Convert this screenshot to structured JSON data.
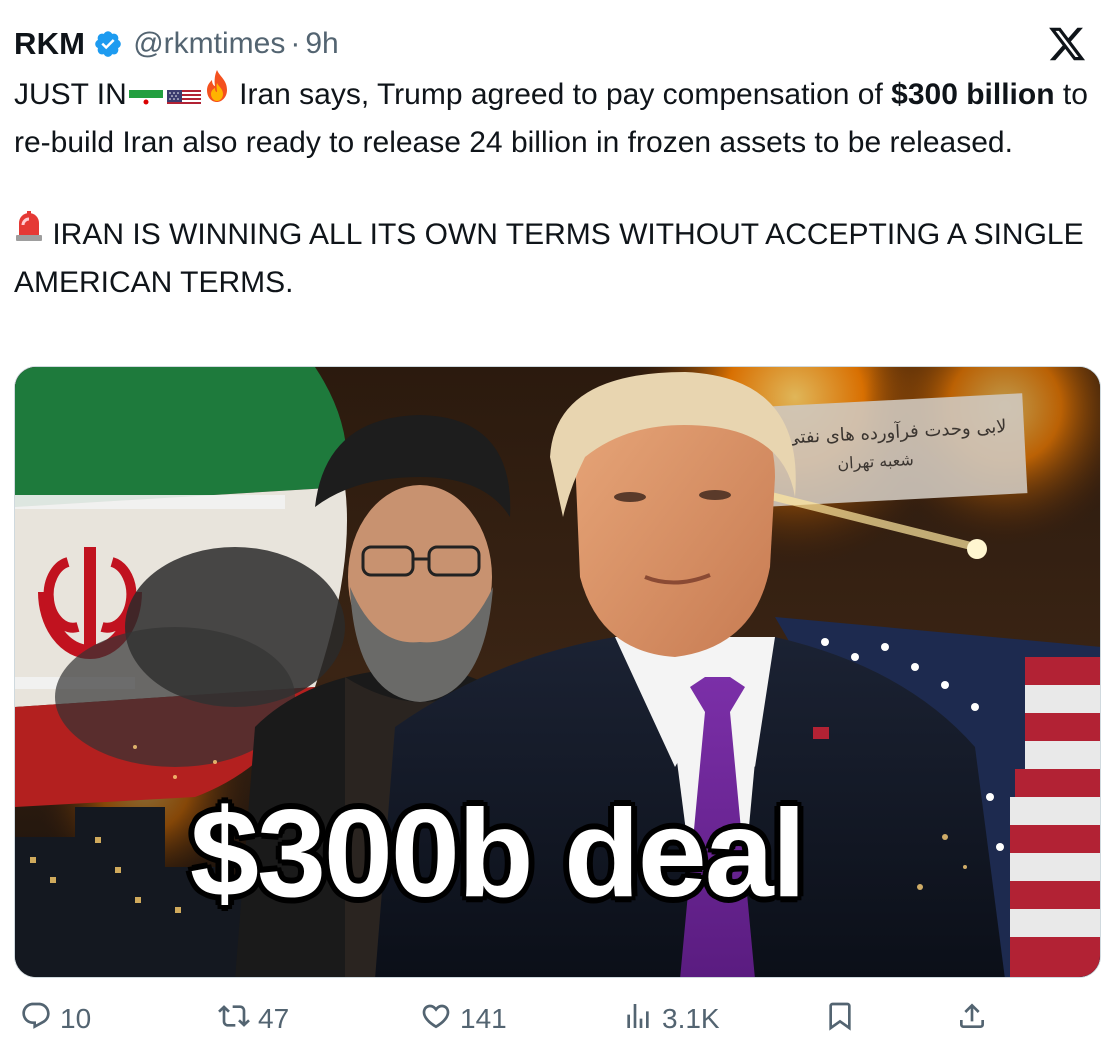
{
  "author": {
    "display_name": "RKM",
    "handle": "@rkmtimes",
    "separator": "·",
    "time": "9h",
    "verified_icon": "verified-badge-icon"
  },
  "platform_logo": "x-logo-icon",
  "tweet": {
    "p1_lead": "JUST IN",
    "p1_after_emoji": " Iran says, Trump agreed to pay compensation of ",
    "p1_bold": "$300 billion",
    "p1_tail": " to re-build Iran also ready to release 24 billion in frozen assets to be released.",
    "p2_text": "IRAN IS WINNING ALL ITS OWN TERMS WITHOUT ACCEPTING A SINGLE AMERICAN TERMS."
  },
  "media": {
    "overlay_text": "$300b deal",
    "sign_line1": "ﻻبی وحدت فرآورده های نفتی ایران",
    "sign_line2": "شعبه تهران"
  },
  "actions": {
    "reply_count": "10",
    "repost_count": "47",
    "like_count": "141",
    "views_count": "3.1K"
  },
  "colors": {
    "verified_blue": "#1d9bf0",
    "secondary_text": "#536471",
    "primary_text": "#0f1419"
  }
}
